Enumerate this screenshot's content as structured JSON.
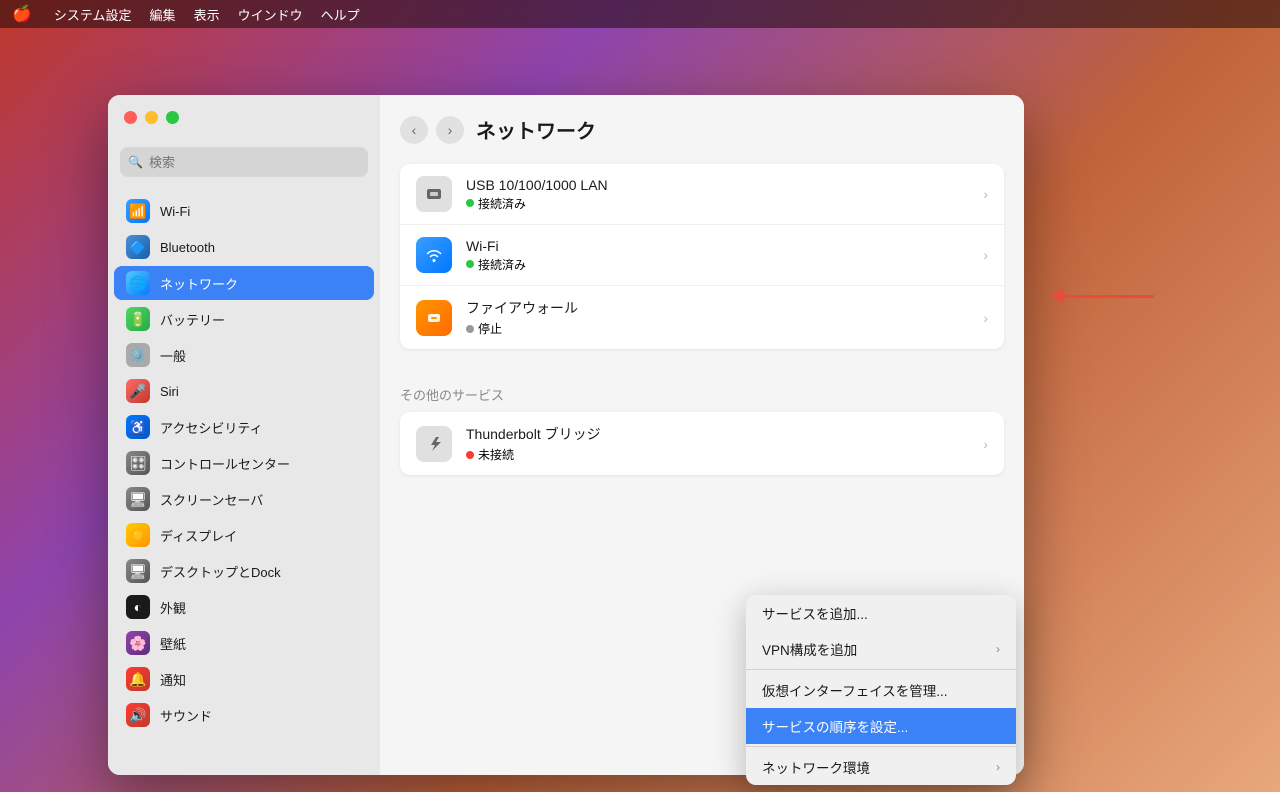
{
  "menubar": {
    "apple": "🍎",
    "items": [
      "システム設定",
      "編集",
      "表示",
      "ウインドウ",
      "ヘルプ"
    ]
  },
  "window": {
    "title": "ネットワーク",
    "sidebar": {
      "search_placeholder": "検索",
      "items": [
        {
          "id": "wifi",
          "label": "Wi-Fi",
          "icon": "wifi"
        },
        {
          "id": "bluetooth",
          "label": "Bluetooth",
          "icon": "bluetooth"
        },
        {
          "id": "network",
          "label": "ネットワーク",
          "icon": "network",
          "active": true
        },
        {
          "id": "battery",
          "label": "バッテリー",
          "icon": "battery"
        },
        {
          "id": "general",
          "label": "一般",
          "icon": "general"
        },
        {
          "id": "siri",
          "label": "Siri",
          "icon": "siri"
        },
        {
          "id": "accessibility",
          "label": "アクセシビリティ",
          "icon": "accessibility"
        },
        {
          "id": "control",
          "label": "コントロールセンター",
          "icon": "control"
        },
        {
          "id": "screensaver",
          "label": "スクリーンセーバ",
          "icon": "screensaver"
        },
        {
          "id": "display",
          "label": "ディスプレイ",
          "icon": "display"
        },
        {
          "id": "dock",
          "label": "デスクトップとDock",
          "icon": "dock"
        },
        {
          "id": "appearance",
          "label": "外観",
          "icon": "appearance"
        },
        {
          "id": "wallpaper",
          "label": "壁紙",
          "icon": "wallpaper"
        },
        {
          "id": "notifications",
          "label": "通知",
          "icon": "notifications"
        },
        {
          "id": "sound",
          "label": "サウンド",
          "icon": "sound"
        }
      ]
    },
    "main": {
      "nav_title": "ネットワーク",
      "network_items": [
        {
          "id": "usb-lan",
          "name": "USB 10/100/1000 LAN",
          "status": "接続済み",
          "status_type": "connected",
          "icon_type": "usb"
        },
        {
          "id": "wifi",
          "name": "Wi-Fi",
          "status": "接続済み",
          "status_type": "connected",
          "icon_type": "wifi"
        },
        {
          "id": "firewall",
          "name": "ファイアウォール",
          "status": "停止",
          "status_type": "stopped",
          "icon_type": "firewall"
        }
      ],
      "other_services_label": "その他のサービス",
      "other_items": [
        {
          "id": "thunderbolt",
          "name": "Thunderbolt ブリッジ",
          "status": "未接続",
          "status_type": "disconnected",
          "icon_type": "thunderbolt"
        }
      ],
      "context_menu": {
        "items": [
          {
            "id": "add-service",
            "label": "サービスを追加...",
            "has_submenu": false
          },
          {
            "id": "add-vpn",
            "label": "VPN構成を追加",
            "has_submenu": true
          },
          {
            "id": "manage-virtual",
            "label": "仮想インターフェイスを管理...",
            "has_submenu": false
          },
          {
            "id": "set-order",
            "label": "サービスの順序を設定...",
            "has_submenu": false,
            "highlighted": true
          },
          {
            "id": "network-env",
            "label": "ネットワーク環境",
            "has_submenu": true
          }
        ]
      }
    }
  }
}
